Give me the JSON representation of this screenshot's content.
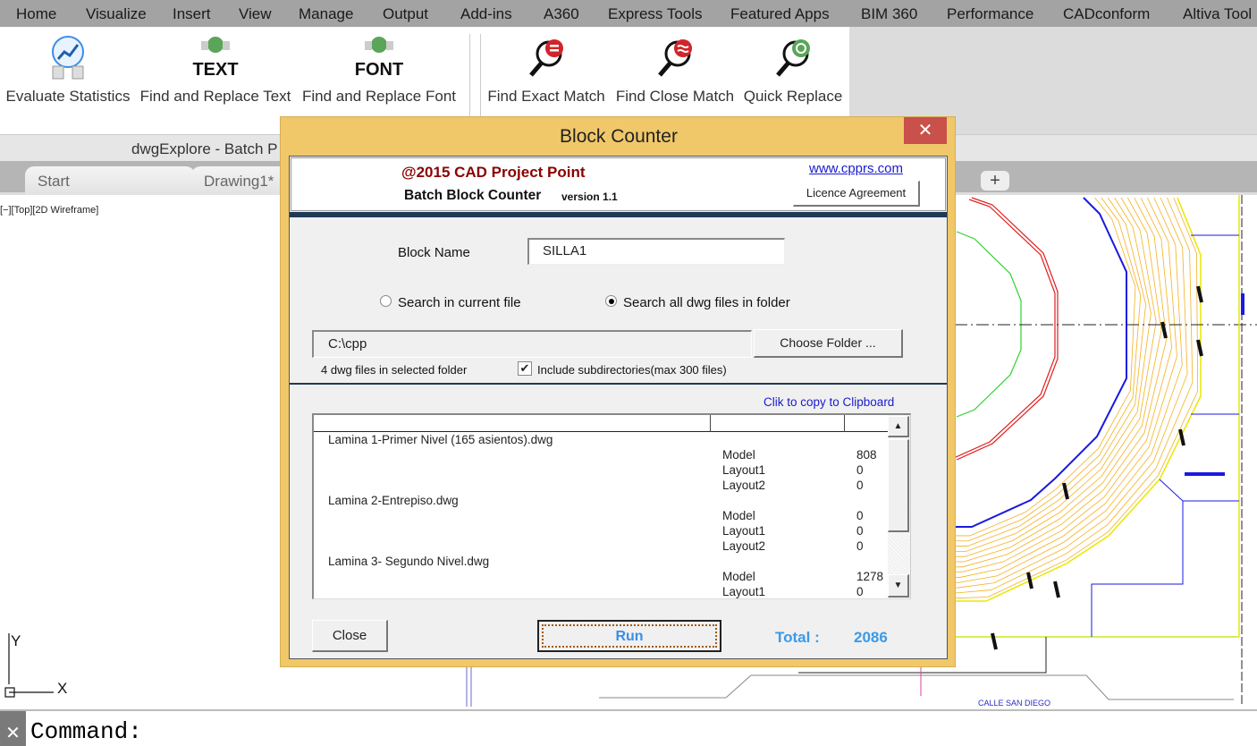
{
  "menu": [
    "Home",
    "Visualize",
    "Insert",
    "View",
    "Manage",
    "Output",
    "Add-ins",
    "A360",
    "Express Tools",
    "Featured Apps",
    "BIM 360",
    "Performance",
    "CADconform",
    "Altiva Tool"
  ],
  "ribbon": [
    {
      "label": "Evaluate Statistics",
      "icon": "statistics-icon"
    },
    {
      "label": "Find and Replace Text",
      "icon": "replace-text-icon",
      "glyph": "TEXT"
    },
    {
      "label": "Find and Replace Font",
      "icon": "replace-font-icon",
      "glyph": "FONT"
    },
    {
      "label": "Find Exact Match",
      "icon": "magnifier-exact-icon"
    },
    {
      "label": "Find Close Match",
      "icon": "magnifier-close-icon"
    },
    {
      "label": "Quick Replace",
      "icon": "magnifier-replace-icon"
    }
  ],
  "panel_title": "dwgExplore - Batch P",
  "tabs": [
    "Start",
    "Drawing1*"
  ],
  "viewport_label": "[−][Top][2D Wireframe]",
  "ucs": {
    "x": "X",
    "y": "Y"
  },
  "drawing_label": "CALLE SAN DIEGO",
  "command": {
    "prompt": "Command:"
  },
  "dialog": {
    "title": "Block Counter",
    "close": "✕",
    "copyright": "@2015 CAD Project Point",
    "product": "Batch Block Counter",
    "version": "version 1.1",
    "website": "www.cpprs.com",
    "licence_button": "Licence Agreement",
    "block_name_label": "Block Name",
    "block_name_value": "SILLA1",
    "radio_current": "Search in current file",
    "radio_folder": "Search all dwg files in folder",
    "radio_selected": "folder",
    "folder_path": "C:\\cpp",
    "choose_folder": "Choose Folder ...",
    "files_count": "4 dwg files in selected folder",
    "include_subdirs": "Include subdirectories(max 300 files)",
    "include_subdirs_checked": true,
    "copy_link": "Clik to copy to Clipboard",
    "results": [
      {
        "file": "Lamina 1-Primer Nivel (165 asientos).dwg",
        "layouts": [
          [
            "Model",
            "808"
          ],
          [
            "Layout1",
            "0"
          ],
          [
            "Layout2",
            "0"
          ]
        ]
      },
      {
        "file": "Lamina 2-Entrepiso.dwg",
        "layouts": [
          [
            "Model",
            "0"
          ],
          [
            "Layout1",
            "0"
          ],
          [
            "Layout2",
            "0"
          ]
        ]
      },
      {
        "file": "Lamina 3- Segundo Nivel.dwg",
        "layouts": [
          [
            "Model",
            "1278"
          ],
          [
            "Layout1",
            "0"
          ]
        ]
      }
    ],
    "close_button": "Close",
    "run_button": "Run",
    "total_label": "Total :",
    "total_value": "2086",
    "colors": {
      "title_bar": "#f0c86a",
      "close": "#c9504b",
      "copyright": "#8b0000",
      "accent_blue": "#3a8ee6",
      "link": "#1a1ad0"
    }
  }
}
